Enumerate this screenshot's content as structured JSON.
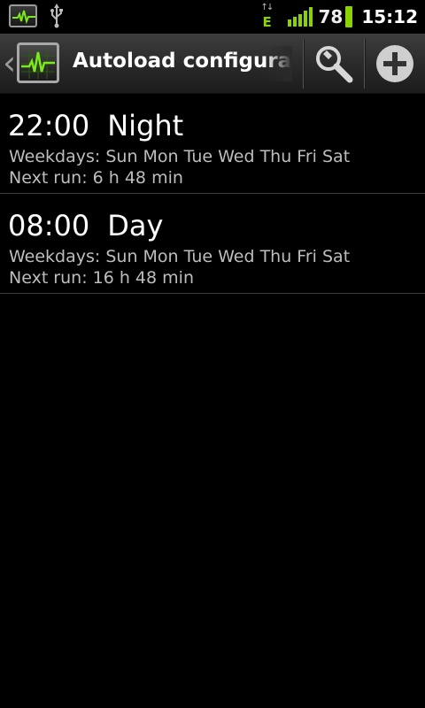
{
  "status_bar": {
    "left_icons": [
      "app-monitor-icon",
      "usb-icon"
    ],
    "network_type": "E",
    "battery_percent": "78",
    "time": "15:12",
    "accent_color": "#8ad300"
  },
  "action_bar": {
    "title": "Autoload configuratio",
    "icons": [
      "back-chevron-icon",
      "app-monitor-icon",
      "wrench-search-icon",
      "add-icon"
    ]
  },
  "schedules": [
    {
      "time": "22:00",
      "name": "Night",
      "weekdays": "Weekdays: Sun Mon Tue Wed Thu Fri Sat",
      "next_run": "Next run: 6 h 48 min"
    },
    {
      "time": "08:00",
      "name": "Day",
      "weekdays": "Weekdays: Sun Mon Tue Wed Thu Fri Sat",
      "next_run": "Next run: 16 h 48 min"
    }
  ]
}
